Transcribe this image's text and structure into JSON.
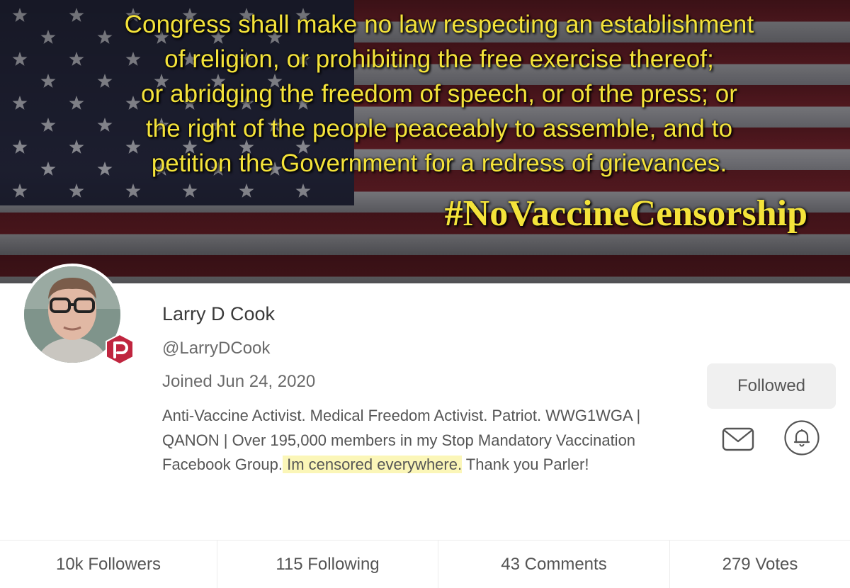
{
  "banner": {
    "quote_lines": [
      "Congress shall make no law respecting an establishment",
      "of religion, or prohibiting the free exercise thereof;",
      "or abridging the freedom of speech, or of the press; or",
      "the right of the people peaceably to assemble, and to",
      "petition the Government for a redress of grievances."
    ],
    "hashtag": "#NoVaccineCensorship",
    "text_color": "#f4e33a"
  },
  "profile": {
    "name": "Larry D Cook",
    "handle": "@LarryDCook",
    "joined": "Joined Jun 24, 2020",
    "bio_plain": "Anti-Vaccine Activist. Medical Freedom Activist. Patriot. WWG1WGA | QANON | Over 195,000 members in my Stop Mandatory Vaccination Facebook Group.",
    "bio_highlight": " Im censored everywhere.",
    "bio_end": " Thank you Parler!",
    "highlight_color": "#fbf6b8",
    "badge_icon": "parler-logo-icon",
    "badge_color": "#c0253f"
  },
  "actions": {
    "follow_label": "Followed",
    "message_icon": "mail-icon",
    "notify_icon": "bell-icon"
  },
  "stats": [
    {
      "label": "10k Followers"
    },
    {
      "label": "115 Following"
    },
    {
      "label": "43 Comments"
    },
    {
      "label": "279 Votes"
    }
  ]
}
